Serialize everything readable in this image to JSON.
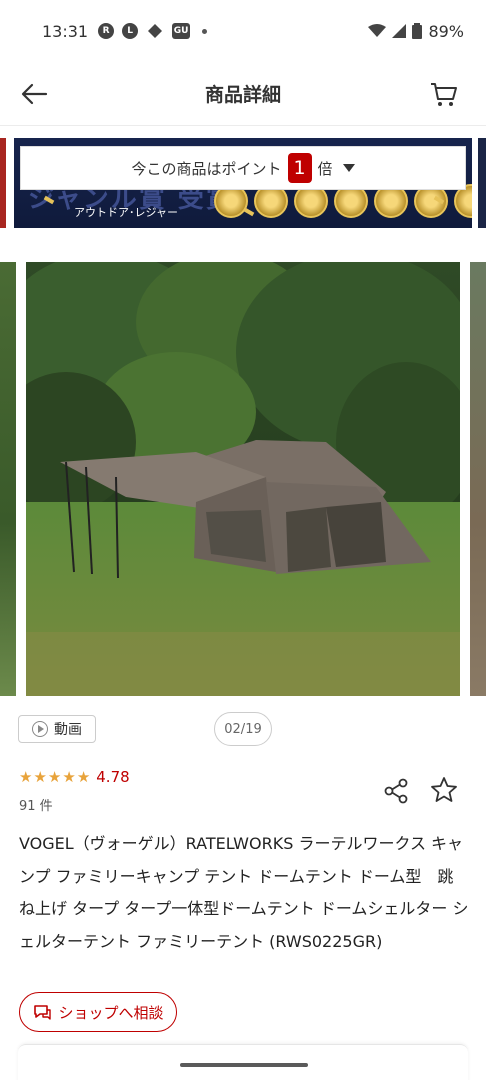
{
  "status_bar": {
    "time": "13:31",
    "icons": [
      "rakuten-icon",
      "line-icon",
      "diamond-icon",
      "gu-icon",
      "dot"
    ],
    "battery": "89%"
  },
  "app_bar": {
    "title": "商品詳細",
    "back_icon": "arrow-left-icon",
    "cart_icon": "cart-icon"
  },
  "banner": {
    "point_text_before": "今この商品はポイント",
    "point_multiplier": "1",
    "point_text_after": "倍",
    "sub_text": "アウトドア･レジャー",
    "big_text": "ジャンル賞 受賞"
  },
  "gallery": {
    "video_label": "動画",
    "counter": "02/19"
  },
  "rating": {
    "stars": 5,
    "score": "4.78",
    "reviews": "91 件"
  },
  "product": {
    "title": "VOGEL（ヴォーゲル）RATELWORKS ラーテルワークス キャンプ ファミリーキャンプ テント ドームテント ドーム型　跳ね上げ タープ タープ一体型ドームテント ドームシェルター シェルターテント ファミリーテント (RWS0225GR)"
  },
  "shop": {
    "consult_label": "ショップへ相談"
  },
  "colors": {
    "accent": "#bf0000",
    "star": "#e8a33b"
  }
}
